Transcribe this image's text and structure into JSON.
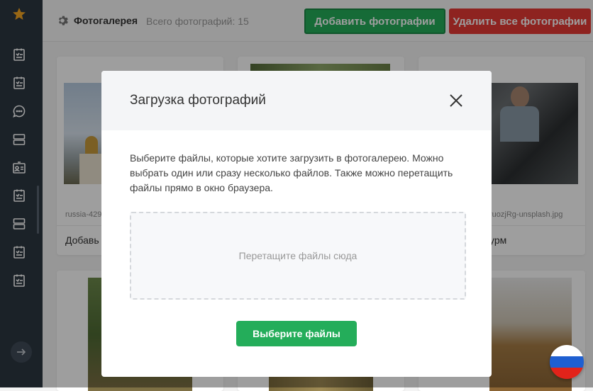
{
  "header": {
    "title": "Фотогалерея",
    "count_text": "Всего фотографий: 15",
    "add_button": "Добавить фотографии",
    "delete_all_button": "Удалить все фотографии",
    "colors": {
      "add": "#24ad5a",
      "delete": "#e53935"
    }
  },
  "sidebar": {
    "items": [
      "star-icon",
      "clipboard-icon",
      "clipboard-icon",
      "chat-icon",
      "list-icon",
      "contact-card-icon",
      "clipboard-icon",
      "list-icon",
      "clipboard-icon",
      "clipboard-icon"
    ],
    "expand_icon": "arrow-right-icon"
  },
  "gallery": {
    "cards": [
      {
        "filename": "russia-429",
        "caption": "Добавь"
      },
      {
        "filename": "",
        "caption": ""
      },
      {
        "filename": "ruozjRg-unsplash.jpg",
        "caption": "урм"
      }
    ]
  },
  "modal": {
    "title": "Загрузка фотографий",
    "description": "Выберите файлы, которые хотите загрузить в фотогалерею. Можно выбрать один или сразу несколько файлов. Также можно перетащить файлы прямо в окно браузера.",
    "dropzone_text": "Перетащите файлы сюда",
    "choose_button": "Выберите файлы"
  },
  "language": {
    "flag": "russia-flag-icon"
  }
}
